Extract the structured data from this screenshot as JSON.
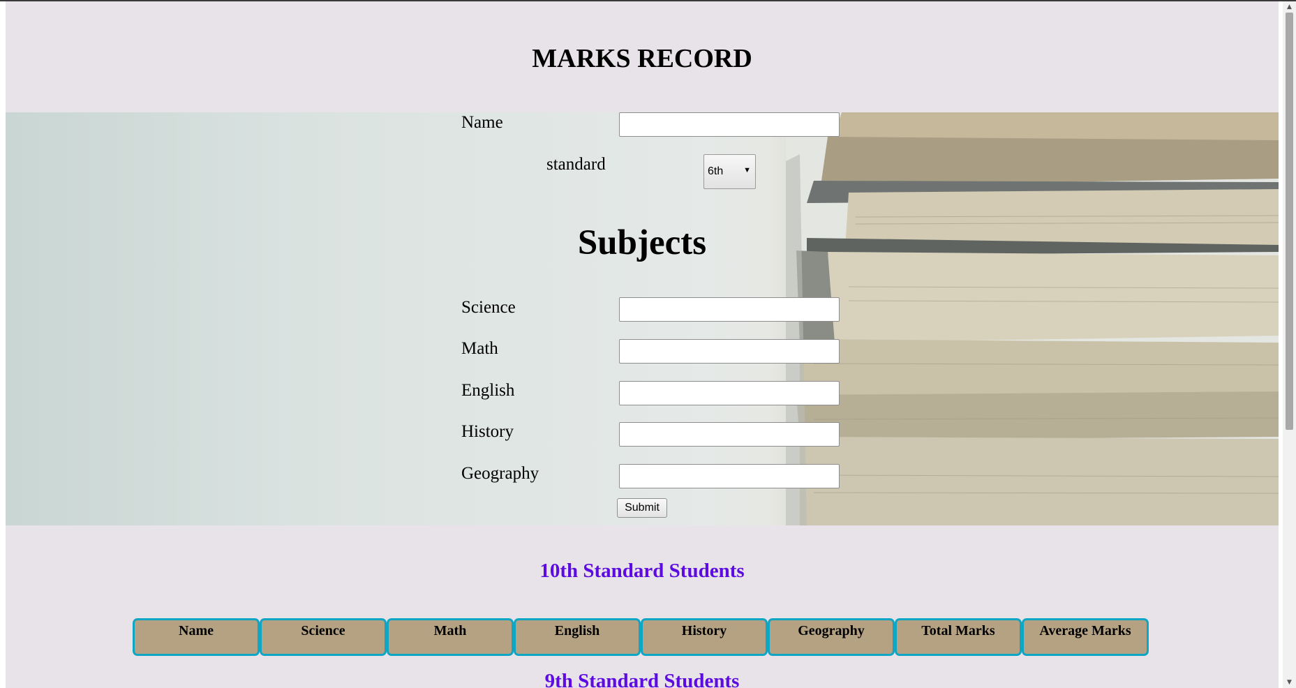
{
  "page": {
    "title": "MARKS RECORD"
  },
  "form": {
    "name_label": "Name",
    "name_value": "",
    "standard_label": "standard",
    "standard_selected": "6th",
    "subjects_heading": "Subjects",
    "science_label": "Science",
    "math_label": "Math",
    "english_label": "English",
    "history_label": "History",
    "geography_label": "Geography",
    "submit_label": "Submit"
  },
  "sections": [
    {
      "title": "10th Standard Students"
    },
    {
      "title": "9th Standard Students"
    }
  ],
  "table": {
    "headers": [
      "Name",
      "Science",
      "Math",
      "English",
      "History",
      "Geography",
      "Total Marks",
      "Average Marks"
    ]
  },
  "colors": {
    "page_bg": "#e8e3e8",
    "section_title": "#5c0be0",
    "header_cell_bg": "#b5a283",
    "header_cell_border": "#0fa5c4"
  }
}
